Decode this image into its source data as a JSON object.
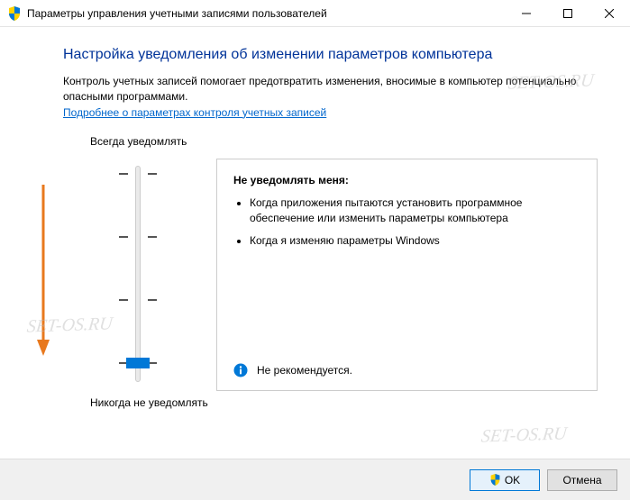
{
  "window": {
    "title": "Параметры управления учетными записями пользователей"
  },
  "heading": "Настройка уведомления об изменении параметров компьютера",
  "description": "Контроль учетных записей помогает предотвратить изменения, вносимые в компьютер потенциально опасными программами.",
  "link": "Подробнее о параметрах контроля учетных записей",
  "slider": {
    "top_label": "Всегда уведомлять",
    "bottom_label": "Никогда не уведомлять",
    "levels": 4,
    "position": 3
  },
  "panel": {
    "title": "Не уведомлять меня:",
    "items": [
      "Когда приложения пытаются установить программное обеспечение или изменить параметры компьютера",
      "Когда я изменяю параметры Windows"
    ],
    "recommendation": "Не рекомендуется."
  },
  "buttons": {
    "ok": "OK",
    "cancel": "Отмена"
  },
  "watermark": "SET-OS.RU"
}
